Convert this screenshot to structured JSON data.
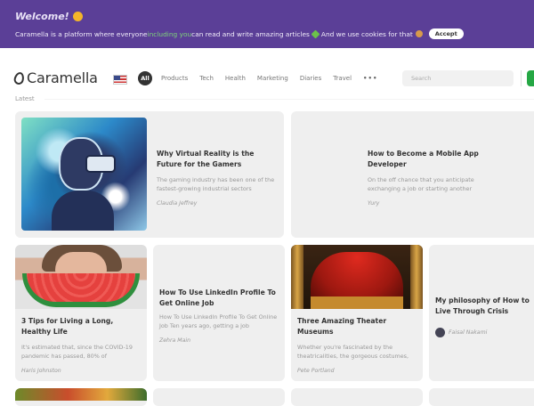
{
  "banner": {
    "welcome": "Welcome!",
    "msg_part1": "Caramella is a platform where everyone ",
    "msg_green": "including you",
    "msg_part2": " can read and write amazing articles",
    "msg_part3": " And we use cookies for that",
    "accept_label": "Accept"
  },
  "header": {
    "logo_text": "Caramella",
    "nav": {
      "all": "All",
      "items": [
        "Products",
        "Tech",
        "Health",
        "Marketing",
        "Diaries",
        "Travel"
      ],
      "more": "•••"
    },
    "search_placeholder": "Search"
  },
  "section_label": "Latest",
  "articles": [
    {
      "title": "Why Virtual Reality is the Future for the Gamers",
      "excerpt": "The gaming industry has been one of the fastest-growing industrial sectors",
      "author": "Claudia Jeffrey"
    },
    {
      "title": "How to Become a Mobile App Developer",
      "excerpt": "On the off chance that you anticipate exchanging a job or starting another",
      "author": "Yury"
    },
    {
      "title": "3 Tips for Living a Long, Healthy Life",
      "excerpt": "It's estimated that, since the COVID-19 pandemic has passed, 80% of",
      "author": "Haris Johnston"
    },
    {
      "title": "How To Use LinkedIn Profile To Get Online Job",
      "excerpt": "How To Use LinkedIn Profile To Get Online Job Ten years ago, getting a job",
      "author": "Zehra Main"
    },
    {
      "title": "Three Amazing Theater Museums",
      "excerpt": "Whether you're fascinated by the theatricalities, the gorgeous costumes,",
      "author": "Pete Portland"
    },
    {
      "title": "My philosophy of How to Live Through Crisis",
      "excerpt": "",
      "author": "Faisal Nakami"
    }
  ],
  "colors": {
    "banner_bg": "#5b3f97",
    "accent_green": "#25a744",
    "card_bg": "#efefef"
  }
}
